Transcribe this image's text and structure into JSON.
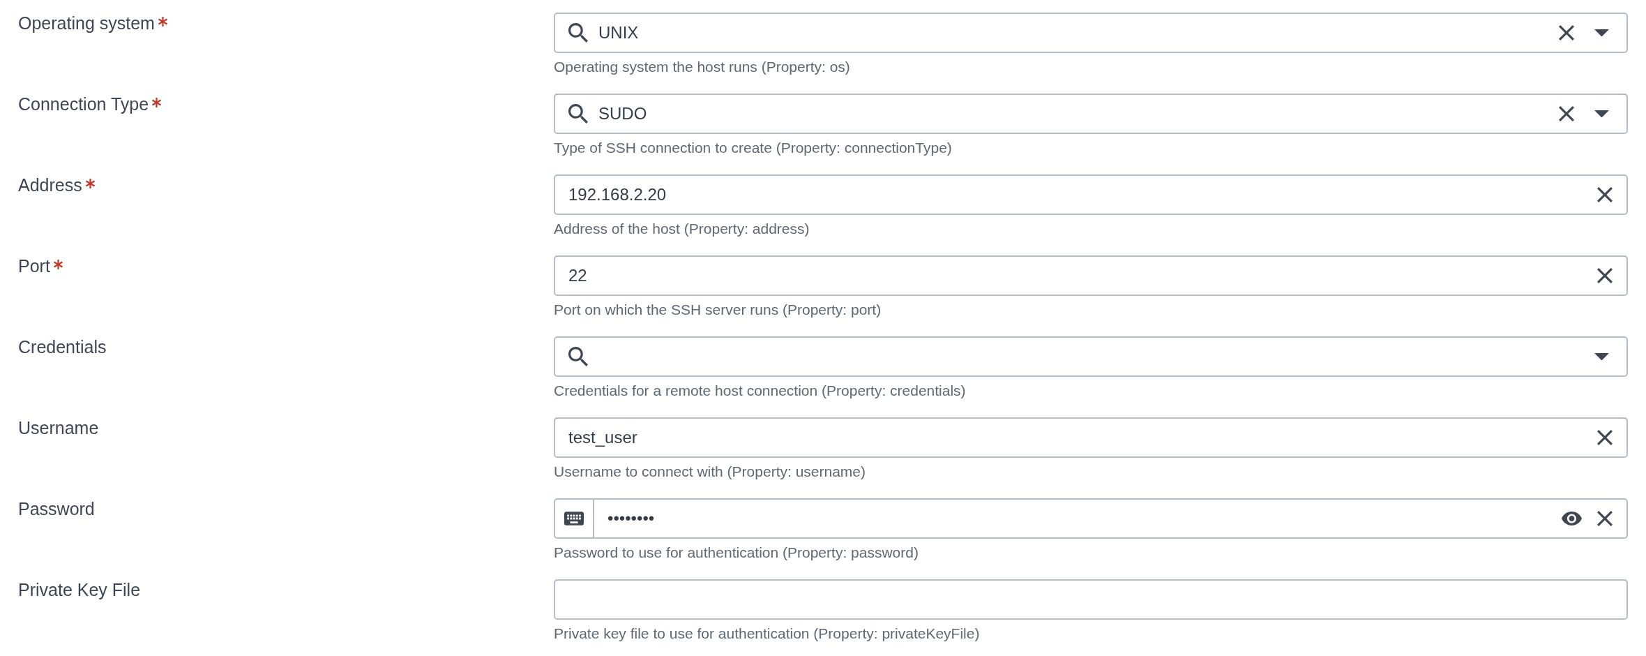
{
  "fields": [
    {
      "label": "Operating system",
      "required": true,
      "kind": "search_select",
      "value": "UNIX",
      "hint": "Operating system the host runs (Property: os)"
    },
    {
      "label": "Connection Type",
      "required": true,
      "kind": "search_select",
      "value": "SUDO",
      "hint": "Type of SSH connection to create (Property: connectionType)"
    },
    {
      "label": "Address",
      "required": true,
      "kind": "text",
      "value": "192.168.2.20",
      "hint": "Address of the host (Property: address)"
    },
    {
      "label": "Port",
      "required": true,
      "kind": "text",
      "value": "22",
      "hint": "Port on which the SSH server runs (Property: port)"
    },
    {
      "label": "Credentials",
      "required": false,
      "kind": "search_select",
      "hint": "Credentials for a remote host connection (Property: credentials)"
    },
    {
      "label": "Username",
      "required": false,
      "kind": "text",
      "value": "test_user",
      "hint": "Username to connect with (Property: username)"
    },
    {
      "label": "Password",
      "required": false,
      "kind": "password",
      "value": "••••••••",
      "hint": "Password to use for authentication (Property: password)"
    },
    {
      "label": "Private Key File",
      "required": false,
      "kind": "text",
      "hint": "Private key file to use for authentication (Property: privateKeyFile)"
    }
  ]
}
